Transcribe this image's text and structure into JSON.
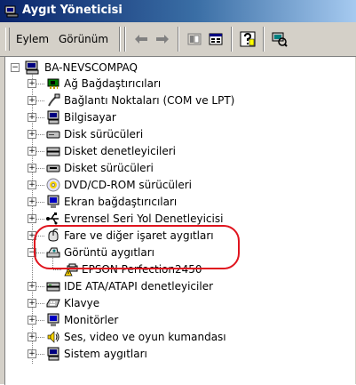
{
  "window": {
    "title": "Aygıt Yöneticisi"
  },
  "menu": {
    "action": "Eylem",
    "view": "Görünüm"
  },
  "tree": {
    "root": "BA-NEVSCOMPAQ",
    "items": [
      {
        "label": "Ağ Bağdaştırıcıları",
        "icon": "network-adapter-icon"
      },
      {
        "label": "Bağlantı Noktaları (COM ve LPT)",
        "icon": "port-icon"
      },
      {
        "label": "Bilgisayar",
        "icon": "computer-icon"
      },
      {
        "label": "Disk sürücüleri",
        "icon": "disk-drive-icon"
      },
      {
        "label": "Disket denetleyicileri",
        "icon": "floppy-controller-icon"
      },
      {
        "label": "Disket sürücüleri",
        "icon": "floppy-drive-icon"
      },
      {
        "label": "DVD/CD-ROM sürücüleri",
        "icon": "cdrom-icon"
      },
      {
        "label": "Ekran bağdaştırıcıları",
        "icon": "display-adapter-icon"
      },
      {
        "label": "Evrensel Seri Yol Denetleyicisi",
        "icon": "usb-icon"
      },
      {
        "label": "Fare ve diğer işaret aygıtları",
        "icon": "mouse-icon"
      },
      {
        "label": "Görüntü aygıtları",
        "icon": "imaging-device-icon"
      },
      {
        "label": "EPSON Perfection2450",
        "icon": "warning-device-icon"
      },
      {
        "label": "IDE ATA/ATAPI denetleyiciler",
        "icon": "ide-controller-icon"
      },
      {
        "label": "Klavye",
        "icon": "keyboard-icon"
      },
      {
        "label": "Monitörler",
        "icon": "monitor-icon"
      },
      {
        "label": "Ses, video ve oyun kumandası",
        "icon": "sound-icon"
      },
      {
        "label": "Sistem aygıtları",
        "icon": "system-device-icon"
      }
    ]
  },
  "colors": {
    "highlight": "#e0141e",
    "title_start": "#0a246a",
    "title_end": "#a6caf0"
  }
}
